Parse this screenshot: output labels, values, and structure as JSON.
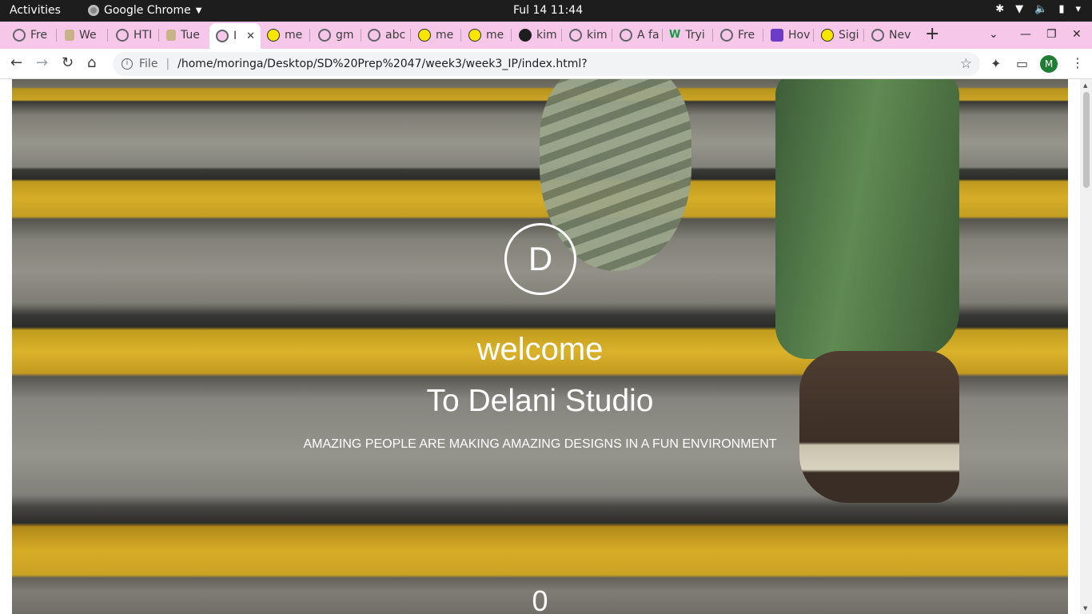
{
  "system": {
    "activities": "Activities",
    "app_name": "Google Chrome",
    "clock": "Ful 14  11:44"
  },
  "tabs": [
    {
      "label": "Fre",
      "icon": "globe-icon"
    },
    {
      "label": "We",
      "icon": "leaf-icon"
    },
    {
      "label": "HTI",
      "icon": "globe-icon"
    },
    {
      "label": "Tue",
      "icon": "leaf-icon"
    },
    {
      "label": "I",
      "icon": "globe-icon",
      "active": true
    },
    {
      "label": "me",
      "icon": "mail-icon"
    },
    {
      "label": "gm",
      "icon": "globe-icon"
    },
    {
      "label": "abc",
      "icon": "globe-icon"
    },
    {
      "label": "me",
      "icon": "mail-icon"
    },
    {
      "label": "me",
      "icon": "mail-icon"
    },
    {
      "label": "kim",
      "icon": "github-icon"
    },
    {
      "label": "kim",
      "icon": "globe-icon"
    },
    {
      "label": "A fa",
      "icon": "globe-icon"
    },
    {
      "label": "Tryi",
      "icon": "w-icon"
    },
    {
      "label": "Fre",
      "icon": "globe-icon"
    },
    {
      "label": "Hov",
      "icon": "doc-icon"
    },
    {
      "label": "Sigi",
      "icon": "mail-icon"
    },
    {
      "label": "Nev",
      "icon": "globe-icon"
    }
  ],
  "toolbar": {
    "file_label": "File",
    "url": "/home/moringa/Desktop/SD%20Prep%2047/week3/week3_IP/index.html?",
    "profile_initial": "M"
  },
  "hero": {
    "logo_letter": "D",
    "welcome": "welcome",
    "title": "To Delani Studio",
    "tagline": "AMAZING PEOPLE ARE MAKING AMAZING DESIGNS IN A FUN ENVIRONMENT",
    "counter": "0"
  },
  "colors": {
    "tabstrip": "#f6c7e9",
    "topbar": "#1d1d1d",
    "stair_yellow": "#eec029"
  }
}
